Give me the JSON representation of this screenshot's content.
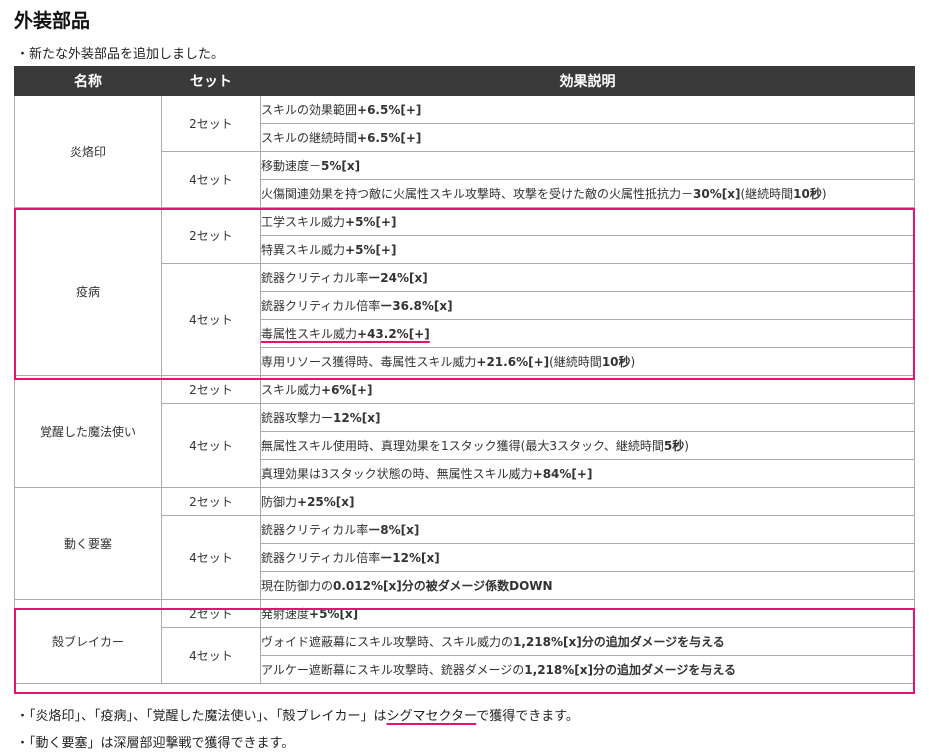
{
  "title": "外装部品",
  "intro": "・新たな外装部品を追加しました。",
  "headers": {
    "name": "名称",
    "set": "セット",
    "effect": "効果説明"
  },
  "parts": [
    {
      "name": "炎烙印",
      "sets": [
        {
          "set": "2セット",
          "effects": [
            {
              "text": "スキルの効果範囲",
              "value": "+6.5%[+]",
              "tail": ""
            },
            {
              "text": "スキルの継続時間",
              "value": "+6.5%[+]",
              "tail": ""
            }
          ]
        },
        {
          "set": "4セット",
          "effects": [
            {
              "text": "移動速度－",
              "value": "5%[x]",
              "tail": ""
            },
            {
              "text": "火傷関連効果を持つ敵に火属性スキル攻撃時、攻撃を受けた敵の火属性抵抗力－",
              "value": "30%[x]",
              "tail": "(継続時間",
              "tailv": "10秒",
              "tailend": ")"
            }
          ]
        }
      ]
    },
    {
      "name": "疫病",
      "sets": [
        {
          "set": "2セット",
          "effects": [
            {
              "text": "工学スキル威力",
              "value": "+5%[+]",
              "tail": ""
            },
            {
              "text": "特異スキル威力",
              "value": "+5%[+]",
              "tail": ""
            }
          ]
        },
        {
          "set": "4セット",
          "effects": [
            {
              "text": "銃器クリティカル率",
              "value": "ー24%[x]",
              "tail": ""
            },
            {
              "text": "銃器クリティカル倍率",
              "value": "ー36.8%[x]",
              "tail": ""
            },
            {
              "text": "毒属性スキル威力",
              "value": "+43.2%[+]",
              "tail": "",
              "underline": true
            },
            {
              "text": "専用リソース獲得時、毒属性スキル威力",
              "value": "+21.6%[+]",
              "tail": "(継続時間",
              "tailv": "10秒",
              "tailend": ")"
            }
          ]
        }
      ]
    },
    {
      "name": "覚醒した魔法使い",
      "sets": [
        {
          "set": "2セット",
          "effects": [
            {
              "text": "スキル威力",
              "value": "+6%[+]",
              "tail": ""
            }
          ]
        },
        {
          "set": "4セット",
          "effects": [
            {
              "text": "銃器攻撃力ー",
              "value": "12%[x]",
              "tail": ""
            },
            {
              "text": "無属性スキル使用時、真理効果を1スタック獲得(最大3スタック、継続時間",
              "value": "5秒",
              "tail": ")"
            },
            {
              "text": "真理効果は3スタック状態の時、無属性スキル威力",
              "value": "+84%[+]",
              "tail": ""
            }
          ]
        }
      ]
    },
    {
      "name": "動く要塞",
      "sets": [
        {
          "set": "2セット",
          "effects": [
            {
              "text": "防御力",
              "value": "+25%[x]",
              "tail": ""
            }
          ]
        },
        {
          "set": "4セット",
          "effects": [
            {
              "text": "銃器クリティカル率",
              "value": "ー8%[x]",
              "tail": ""
            },
            {
              "text": "銃器クリティカル倍率",
              "value": "ー12%[x]",
              "tail": ""
            },
            {
              "text": "現在防御力の",
              "value": "0.012%[x]分の被ダメージ係数DOWN",
              "tail": ""
            }
          ]
        }
      ]
    },
    {
      "name": "殻ブレイカー",
      "sets": [
        {
          "set": "2セット",
          "effects": [
            {
              "text": "発射速度",
              "value": "+5%[x]",
              "tail": ""
            }
          ]
        },
        {
          "set": "4セット",
          "effects": [
            {
              "text": "ヴォイド遮蔽幕にスキル攻撃時、スキル威力の",
              "value": "1,218%[x]分の追加ダメージを与える",
              "tail": ""
            },
            {
              "text": "アルケー遮断幕にスキル攻撃時、銃器ダメージの",
              "value": "1,218%[x]分の追加ダメージを与える",
              "tail": ""
            }
          ]
        }
      ]
    }
  ],
  "footnote1": "・「炎烙印」、「疫病」、「覚醒した魔法使い」、「殻ブレイカー」は",
  "footnote1_link": "シグマセクター",
  "footnote1_end": "で獲得できます。",
  "footnote2": "・「動く要塞」は深層部迎撃戦で獲得できます。",
  "highlight_color": "#e8116e"
}
